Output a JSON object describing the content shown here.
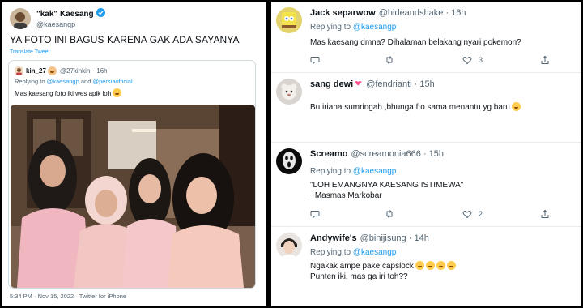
{
  "main_tweet": {
    "display_name": "\"kak\" Kaesang",
    "handle": "@kaesangp",
    "text": "YA FOTO INI BAGUS KARENA GAK ADA SAYANYA",
    "translate_label": "Translate Tweet",
    "footer": "5:34 PM · Nov 15, 2022 · Twitter for iPhone",
    "quote": {
      "name": "kin_27",
      "handle": "@27kinkin",
      "time": "· 16h",
      "replying_prefix": "Replying to",
      "replying_to_1": "@kaesangp",
      "and_word": "and",
      "replying_to_2": "@persiaofficial",
      "text": "Mas kaesang foto iki wes apik loh"
    }
  },
  "replies": [
    {
      "name": "Jack separwow",
      "handle": "@hideandshake",
      "time": "· 16h",
      "replying_prefix": "Replying to",
      "replying_to": "@kaesangp",
      "lines": [
        "Mas kaesang dmna? Dihalaman belakang nyari pokemon?"
      ],
      "like_count": "3"
    },
    {
      "name": "sang dewi",
      "handle": "@fendrianti",
      "time": "· 15h",
      "lines": [
        "Bu iriana sumringah ,bhunga fto sama menantu yg baru"
      ],
      "like_count": ""
    },
    {
      "name": "Screamo",
      "handle": "@screamonia666",
      "time": "· 15h",
      "replying_prefix": "Replying to",
      "replying_to": "@kaesangp",
      "lines": [
        "\"LOH EMANGNYA KAESANG ISTIMEWA\"",
        "~Masmas Markobar"
      ],
      "like_count": "2"
    },
    {
      "name": "Andywife's",
      "handle": "@binijisung",
      "time": "· 14h",
      "replying_prefix": "Replying to",
      "replying_to": "@kaesangp",
      "lines": [
        "Ngakak ampe pake capslock",
        "Punten iki, mas ga iri toh??"
      ],
      "like_count": ""
    }
  ],
  "colors": {
    "accent": "#1d9bf0",
    "muted_text": "#536471",
    "divider": "#e6ecf0",
    "background": "#ffffff"
  }
}
